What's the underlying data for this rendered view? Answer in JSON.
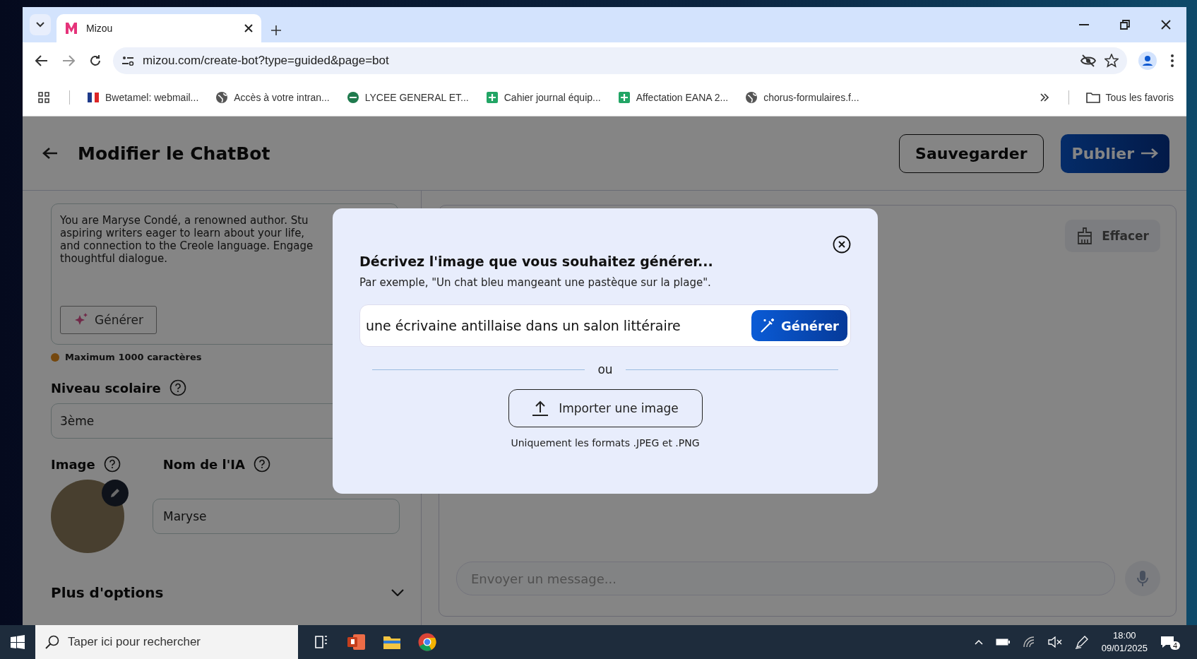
{
  "browser": {
    "tabs": [
      {
        "title": "Mizou",
        "selected": true
      }
    ],
    "url": "mizou.com/create-bot?type=guided&page=bot",
    "bookmarks": [
      {
        "label": "Bwetamel: webmail...",
        "kind": "flag"
      },
      {
        "label": "Accès à votre intran...",
        "kind": "globe"
      },
      {
        "label": "LYCEE GENERAL ET...",
        "kind": "badge"
      },
      {
        "label": "Cahier journal équip...",
        "kind": "sheet"
      },
      {
        "label": "Affectation EANA 2...",
        "kind": "sheet"
      },
      {
        "label": "chorus-formulaires.f...",
        "kind": "globe"
      }
    ],
    "all_bookmarks": "Tous les favoris"
  },
  "header": {
    "title": "Modifier le ChatBot",
    "save_button": "Sauvegarder",
    "publish_button": "Publier"
  },
  "left_panel": {
    "instructions_lines": [
      "You are Maryse Condé, a renowned author. Stu",
      "aspiring writers eager to learn about your life,",
      "and connection to the Creole language. Engage",
      "thoughtful dialogue."
    ],
    "generate_button": "Générer",
    "limit_note": "Maximum 1000 caractères",
    "grade_label": "Niveau scolaire",
    "grade_value": "3ème",
    "image_label": "Image",
    "ai_name_label": "Nom de l'IA",
    "ai_name_value": "Maryse",
    "more_options": "Plus d'options"
  },
  "chat_panel": {
    "clear_button": "Effacer",
    "message_placeholder": "Envoyer un message..."
  },
  "modal": {
    "title": "Décrivez l'image que vous souhaitez générer...",
    "example": "Par exemple, \"Un chat bleu mangeant une pastèque sur la plage\".",
    "prompt_value": "une écrivaine antillaise dans un salon littéraire",
    "generate_button": "Générer",
    "separator": "ou",
    "upload_button": "Importer une image",
    "formats_note": "Uniquement les formats .JPEG et .PNG"
  },
  "taskbar": {
    "search_placeholder": "Taper ici pour rechercher",
    "time": "18:00",
    "date": "09/01/2025",
    "notifications": "4"
  }
}
